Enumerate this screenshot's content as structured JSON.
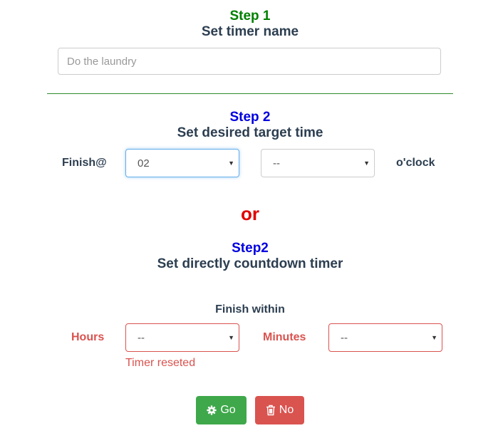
{
  "step1": {
    "title": "Step 1",
    "subtitle": "Set timer name",
    "name_placeholder": "Do the laundry",
    "title_color": "#008000"
  },
  "step2": {
    "title": "Step 2",
    "subtitle": "Set desired target time",
    "finish_label": "Finish@",
    "hour_value": "02",
    "minute_value": "--",
    "oclock_label": "o'clock",
    "title_color": "#0000e0"
  },
  "separator": {
    "or_label": "or",
    "color": "#e00000"
  },
  "step2b": {
    "title": "Step2",
    "subtitle": "Set directly countdown timer",
    "finish_within_label": "Finish within",
    "hours_label": "Hours",
    "hours_value": "--",
    "minutes_label": "Minutes",
    "minutes_value": "--",
    "error_text": "Timer reseted",
    "error_color": "#d9534f"
  },
  "buttons": {
    "go_label": "Go",
    "no_label": "No",
    "go_icon": "gear-icon",
    "no_icon": "trash-icon",
    "go_color": "#3ea84a",
    "no_color": "#d9534f"
  }
}
